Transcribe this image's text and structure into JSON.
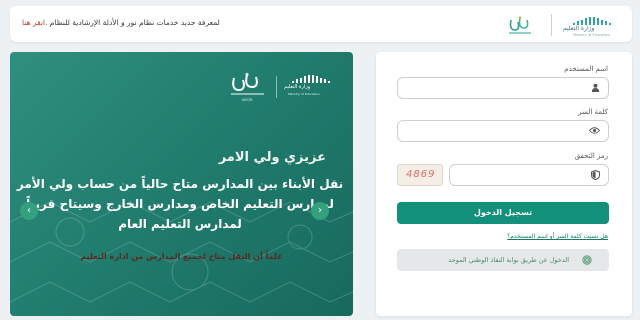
{
  "header": {
    "notice_text": "لمعرفة جديد خدمات نظام نور و الأدلة الإرشادية للنظام ",
    "notice_link": ".انقر هنا",
    "moe_logo_text": "وزارة التعليم",
    "moe_logo_sub": "Ministry of Education"
  },
  "hero": {
    "moe_title": "وزارة التعليم",
    "moe_sub": "Ministry of Education",
    "noor_sub": "NOOR",
    "greeting": "عزيزي ولي الامر",
    "message_line1": "نقل الأبناء بين المدارس متاح حالياً من حساب ولي الأمر",
    "message_line2": "لمدارس التعليم الخاص ومدارس الخارج وسيتاح قريباً",
    "message_line3": "لمدارس التعليم العام",
    "note": "علماً أن النقل متاح لجميع المدارس من ادارة التعليم",
    "arrow_left": "‹",
    "arrow_right": "›"
  },
  "login": {
    "username_label": "اسم المستخدم",
    "username_value": "",
    "password_label": "كلمة السر",
    "password_value": "",
    "captcha_label": "رمز التحقق",
    "captcha_value": "",
    "captcha_image_text": "4869",
    "submit_label": "تسجيل الدخول",
    "forgot_link": "هل نسيت كلمة السر أو اسم المستخدم؟",
    "nafath_label": "الدخول عن طريق بوابة النفاذ الوطني الموحد"
  },
  "colors": {
    "primary": "#13907a",
    "hero_bg": "#1f7a6c",
    "note_text": "#5b2a22",
    "page_bg": "#eef1f3"
  },
  "icons": {
    "username": "user-icon",
    "password": "eye-icon",
    "captcha": "shield-icon",
    "nafath": "fingerprint-icon"
  }
}
